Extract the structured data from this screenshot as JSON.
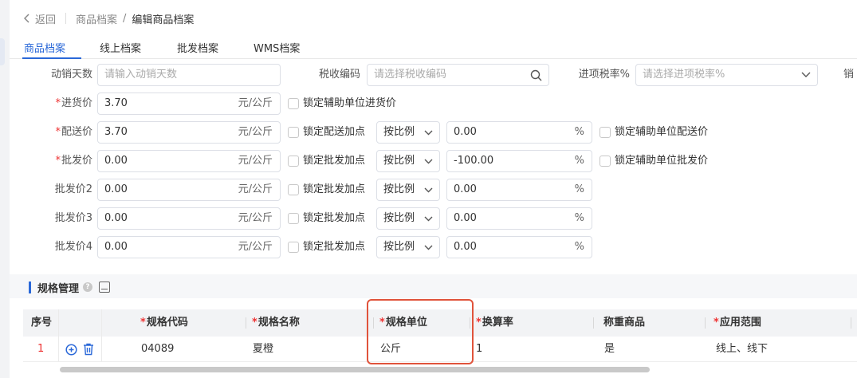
{
  "breadcrumb": {
    "back": "返回",
    "parent": "商品档案",
    "separator": "/",
    "current": "编辑商品档案"
  },
  "tabs": [
    "商品档案",
    "线上档案",
    "批发档案",
    "WMS档案"
  ],
  "top_row": {
    "days_label": "动销天数",
    "days_placeholder": "请输入动销天数",
    "tax_code_label": "税收编码",
    "tax_code_placeholder": "请选择税收编码",
    "input_tax_label": "进项税率%",
    "input_tax_placeholder": "请选择进项税率%",
    "cut_label": "销"
  },
  "prices": [
    {
      "label": "进货价",
      "required": "*",
      "value": "3.70",
      "unit": "元/公斤",
      "lock_label": "锁定辅助单位进货价"
    },
    {
      "label": "配送价",
      "required": "*",
      "value": "3.70",
      "unit": "元/公斤",
      "lock_label": "锁定配送加点",
      "mode": "按比例",
      "percent": "0.00",
      "pct_sign": "%",
      "aux_lock_label": "锁定辅助单位配送价"
    },
    {
      "label": "批发价",
      "required": "*",
      "value": "0.00",
      "unit": "元/公斤",
      "lock_label": "锁定批发加点",
      "mode": "按比例",
      "percent": "-100.00",
      "pct_sign": "%",
      "aux_lock_label": "锁定辅助单位批发价"
    },
    {
      "label": "批发价2",
      "required": "",
      "value": "0.00",
      "unit": "元/公斤",
      "lock_label": "锁定批发加点",
      "mode": "按比例",
      "percent": "0.00",
      "pct_sign": "%"
    },
    {
      "label": "批发价3",
      "required": "",
      "value": "0.00",
      "unit": "元/公斤",
      "lock_label": "锁定批发加点",
      "mode": "按比例",
      "percent": "0.00",
      "pct_sign": "%"
    },
    {
      "label": "批发价4",
      "required": "",
      "value": "0.00",
      "unit": "元/公斤",
      "lock_label": "锁定批发加点",
      "mode": "按比例",
      "percent": "0.00",
      "pct_sign": "%"
    }
  ],
  "spec_section": {
    "title": "规格管理",
    "help": "?",
    "columns": [
      "序号",
      "规格代码",
      "规格名称",
      "规格单位",
      "换算率",
      "称重商品",
      "应用范围"
    ],
    "required_mark": "*",
    "row": {
      "index": "1",
      "code": "04089",
      "name": "夏橙",
      "unit": "公斤",
      "ratio": "1",
      "weighing": "是",
      "scope": "线上、线下"
    }
  },
  "colors": {
    "accent": "#2a68d8",
    "required": "#e33333",
    "highlight": "#e0533b"
  }
}
